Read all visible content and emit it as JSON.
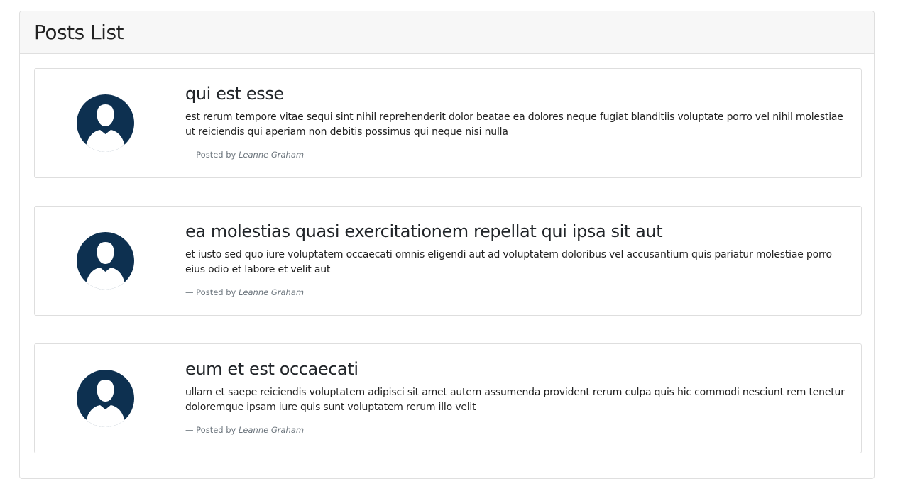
{
  "header": {
    "title": "Posts List"
  },
  "posts": [
    {
      "title": "qui est esse",
      "body": "est rerum tempore vitae sequi sint nihil reprehenderit dolor beatae ea dolores neque fugiat blanditiis voluptate porro vel nihil molestiae ut reiciendis qui aperiam non debitis possimus qui neque nisi nulla",
      "meta_prefix": "— Posted by",
      "author": "Leanne Graham",
      "avatar_icon": "user-avatar-icon"
    },
    {
      "title": "ea molestias quasi exercitationem repellat qui ipsa sit aut",
      "body": "et iusto sed quo iure voluptatem occaecati omnis eligendi aut ad voluptatem doloribus vel accusantium quis pariatur molestiae porro eius odio et labore et velit aut",
      "meta_prefix": "— Posted by",
      "author": "Leanne Graham",
      "avatar_icon": "user-avatar-icon"
    },
    {
      "title": "eum et est occaecati",
      "body": "ullam et saepe reiciendis voluptatem adipisci sit amet autem assumenda provident rerum culpa quis hic commodi nesciunt rem tenetur doloremque ipsam iure quis sunt voluptatem rerum illo velit",
      "meta_prefix": "— Posted by",
      "author": "Leanne Graham",
      "avatar_icon": "user-avatar-icon"
    }
  ],
  "colors": {
    "avatar_bg": "#0d3050",
    "header_bg": "#f7f7f7",
    "border": "#dfdfdf",
    "meta_text": "#6c757d"
  }
}
